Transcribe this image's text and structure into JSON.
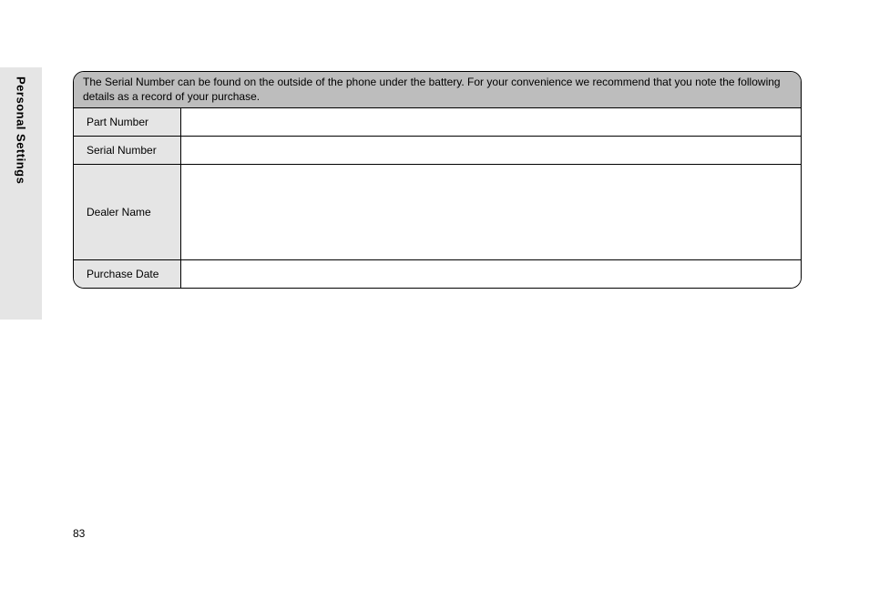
{
  "side_tab": {
    "label": "Personal Settings"
  },
  "record_box": {
    "header_text": "The Serial Number can be found on the outside of the phone under the battery. For your convenience we recommend that you note the following details as a record of your purchase.",
    "rows": {
      "part_number": {
        "label": "Part Number",
        "value": ""
      },
      "serial_number": {
        "label": "Serial Number",
        "value": ""
      },
      "dealer_name": {
        "label": "Dealer Name",
        "value": ""
      },
      "purchase_date": {
        "label": "Purchase Date",
        "value": ""
      }
    }
  },
  "page_number": "83"
}
